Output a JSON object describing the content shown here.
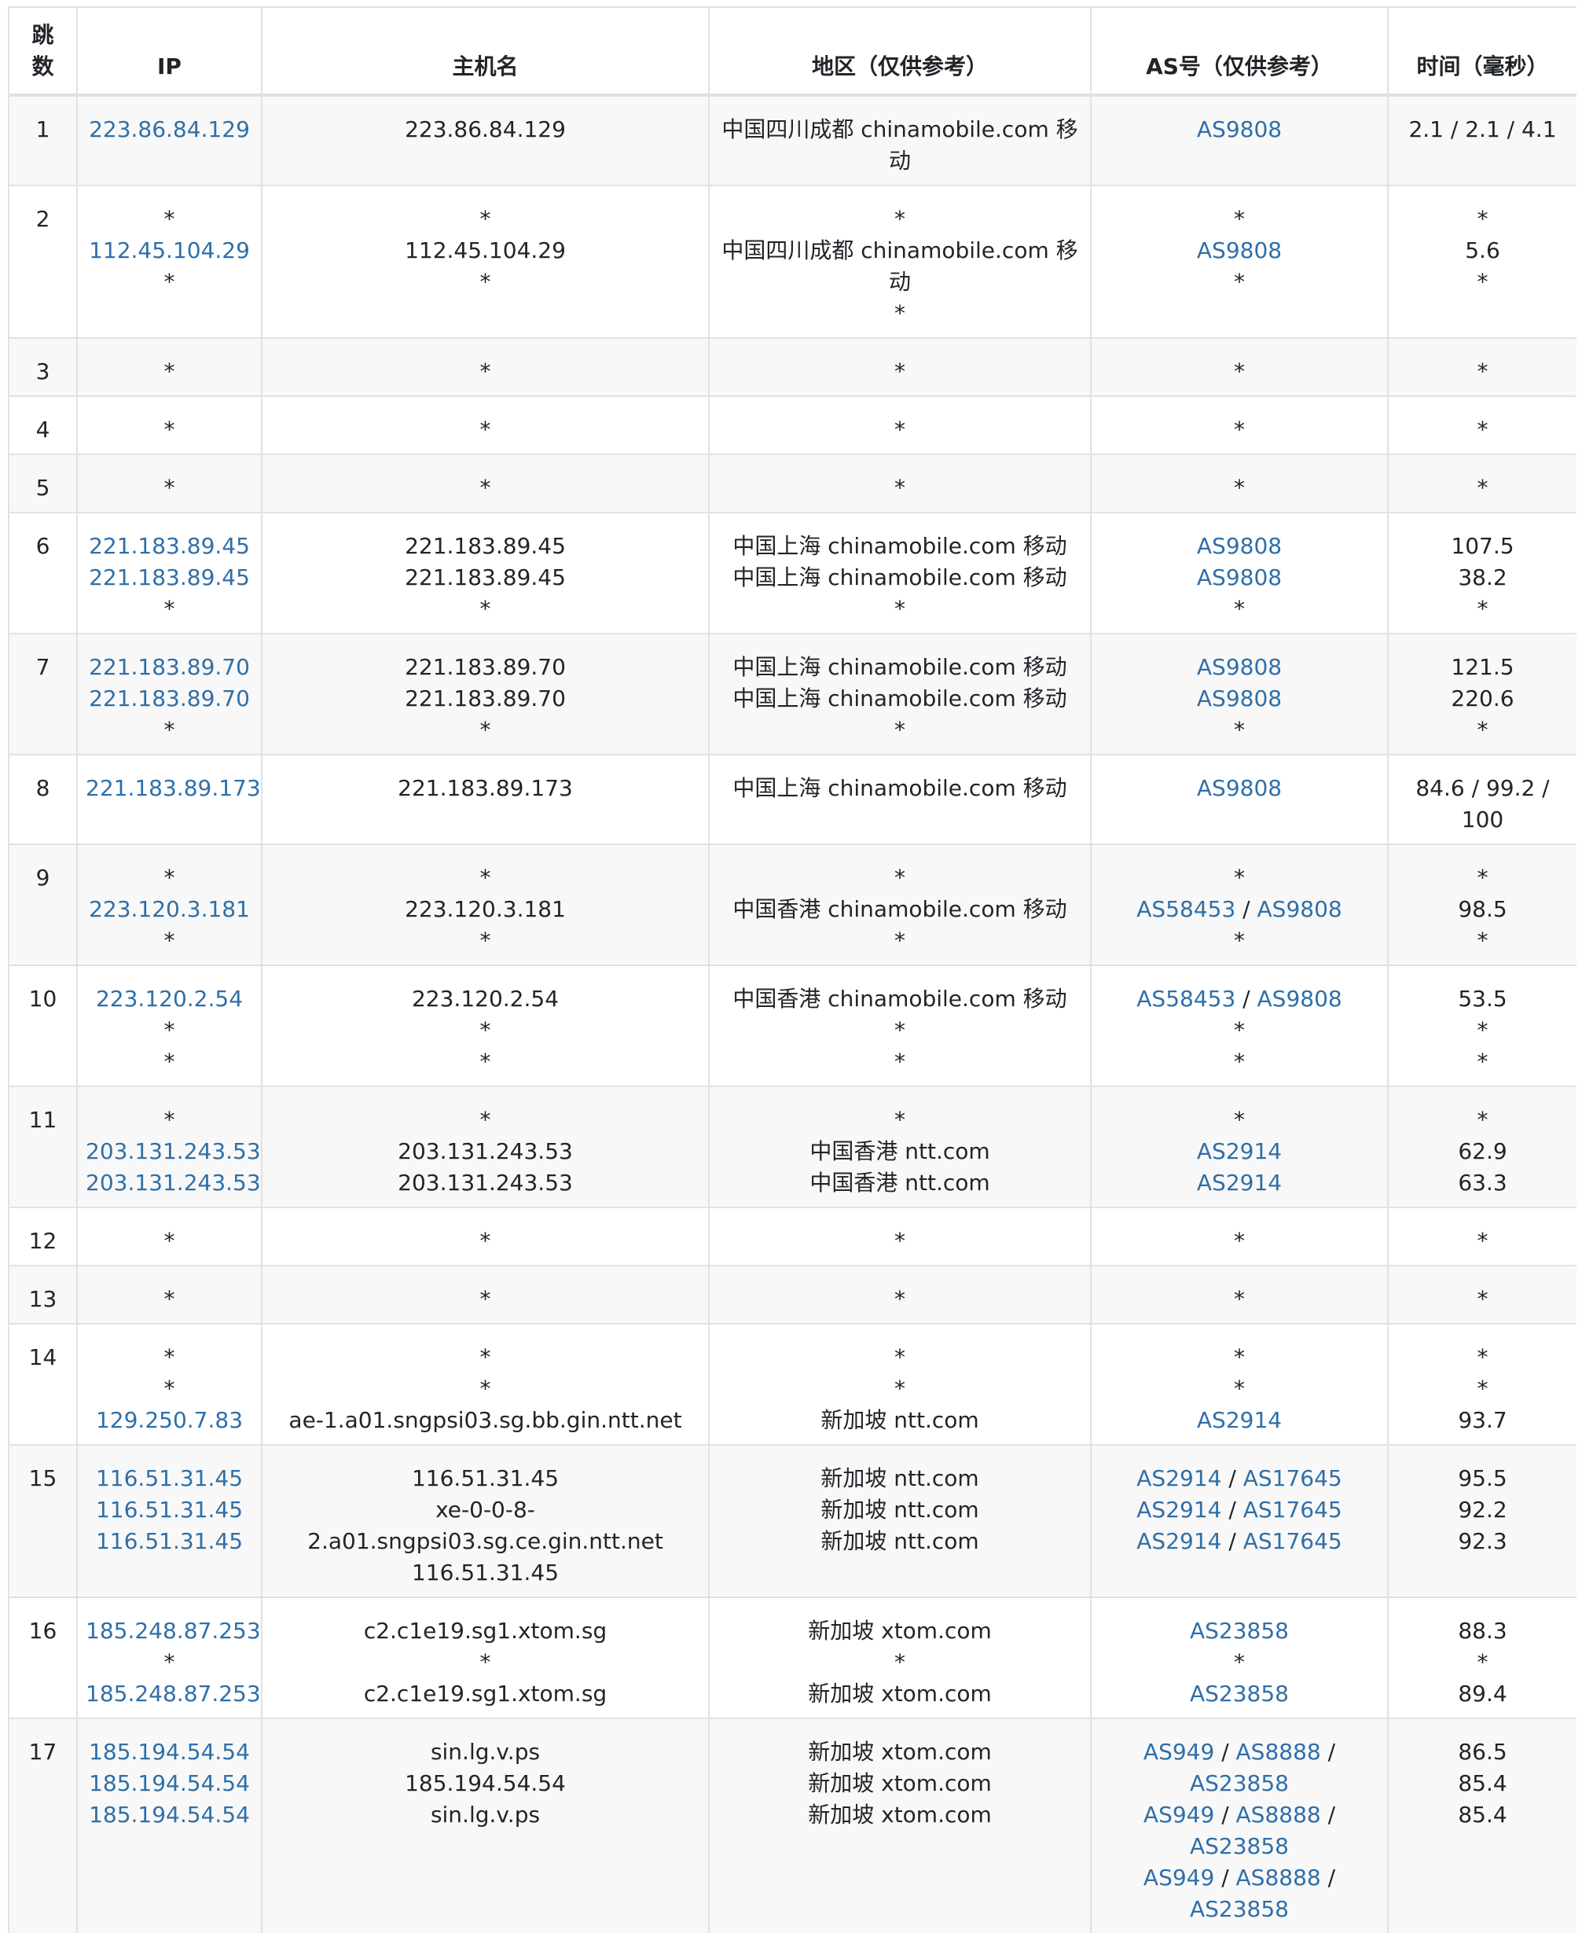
{
  "columns": [
    "跳数",
    "IP",
    "主机名",
    "地区（仅供参考）",
    "AS号（仅供参考）",
    "时间（毫秒）"
  ],
  "hop_header_lines": [
    "跳",
    "数"
  ],
  "rows": [
    {
      "hop": "1",
      "ip": [
        "223.86.84.129"
      ],
      "host": [
        "223.86.84.129"
      ],
      "region": [
        "中国四川成都 chinamobile.com 移动"
      ],
      "as": [
        [
          "AS9808"
        ]
      ],
      "time": [
        "2.1 / 2.1 / 4.1"
      ]
    },
    {
      "hop": "2",
      "ip": [
        "*",
        "112.45.104.29",
        "*"
      ],
      "host": [
        "*",
        "112.45.104.29",
        "*"
      ],
      "region": [
        "*",
        "中国四川成都 chinamobile.com 移动",
        "*"
      ],
      "as": [
        [
          "*"
        ],
        [
          "AS9808"
        ],
        [
          "*"
        ]
      ],
      "time": [
        "*",
        "5.6",
        "*"
      ]
    },
    {
      "hop": "3",
      "ip": [
        "*"
      ],
      "host": [
        "*"
      ],
      "region": [
        "*"
      ],
      "as": [
        [
          "*"
        ]
      ],
      "time": [
        "*"
      ]
    },
    {
      "hop": "4",
      "ip": [
        "*"
      ],
      "host": [
        "*"
      ],
      "region": [
        "*"
      ],
      "as": [
        [
          "*"
        ]
      ],
      "time": [
        "*"
      ]
    },
    {
      "hop": "5",
      "ip": [
        "*"
      ],
      "host": [
        "*"
      ],
      "region": [
        "*"
      ],
      "as": [
        [
          "*"
        ]
      ],
      "time": [
        "*"
      ]
    },
    {
      "hop": "6",
      "ip": [
        "221.183.89.45",
        "221.183.89.45",
        "*"
      ],
      "host": [
        "221.183.89.45",
        "221.183.89.45",
        "*"
      ],
      "region": [
        "中国上海 chinamobile.com 移动",
        "中国上海 chinamobile.com 移动",
        "*"
      ],
      "as": [
        [
          "AS9808"
        ],
        [
          "AS9808"
        ],
        [
          "*"
        ]
      ],
      "time": [
        "107.5",
        "38.2",
        "*"
      ]
    },
    {
      "hop": "7",
      "ip": [
        "221.183.89.70",
        "221.183.89.70",
        "*"
      ],
      "host": [
        "221.183.89.70",
        "221.183.89.70",
        "*"
      ],
      "region": [
        "中国上海 chinamobile.com 移动",
        "中国上海 chinamobile.com 移动",
        "*"
      ],
      "as": [
        [
          "AS9808"
        ],
        [
          "AS9808"
        ],
        [
          "*"
        ]
      ],
      "time": [
        "121.5",
        "220.6",
        "*"
      ]
    },
    {
      "hop": "8",
      "ip": [
        "221.183.89.173"
      ],
      "host": [
        "221.183.89.173"
      ],
      "region": [
        "中国上海 chinamobile.com 移动"
      ],
      "as": [
        [
          "AS9808"
        ]
      ],
      "time": [
        "84.6 / 99.2 / 100"
      ]
    },
    {
      "hop": "9",
      "ip": [
        "*",
        "223.120.3.181",
        "*"
      ],
      "host": [
        "*",
        "223.120.3.181",
        "*"
      ],
      "region": [
        "*",
        "中国香港 chinamobile.com 移动",
        "*"
      ],
      "as": [
        [
          "*"
        ],
        [
          "AS58453",
          "AS9808"
        ],
        [
          "*"
        ]
      ],
      "time": [
        "*",
        "98.5",
        "*"
      ]
    },
    {
      "hop": "10",
      "ip": [
        "223.120.2.54",
        "*",
        "*"
      ],
      "host": [
        "223.120.2.54",
        "*",
        "*"
      ],
      "region": [
        "中国香港 chinamobile.com 移动",
        "*",
        "*"
      ],
      "as": [
        [
          "AS58453",
          "AS9808"
        ],
        [
          "*"
        ],
        [
          "*"
        ]
      ],
      "time": [
        "53.5",
        "*",
        "*"
      ]
    },
    {
      "hop": "11",
      "ip": [
        "*",
        "203.131.243.53",
        "203.131.243.53"
      ],
      "host": [
        "*",
        "203.131.243.53",
        "203.131.243.53"
      ],
      "region": [
        "*",
        "中国香港 ntt.com",
        "中国香港 ntt.com"
      ],
      "as": [
        [
          "*"
        ],
        [
          "AS2914"
        ],
        [
          "AS2914"
        ]
      ],
      "time": [
        "*",
        "62.9",
        "63.3"
      ]
    },
    {
      "hop": "12",
      "ip": [
        "*"
      ],
      "host": [
        "*"
      ],
      "region": [
        "*"
      ],
      "as": [
        [
          "*"
        ]
      ],
      "time": [
        "*"
      ]
    },
    {
      "hop": "13",
      "ip": [
        "*"
      ],
      "host": [
        "*"
      ],
      "region": [
        "*"
      ],
      "as": [
        [
          "*"
        ]
      ],
      "time": [
        "*"
      ]
    },
    {
      "hop": "14",
      "ip": [
        "*",
        "*",
        "129.250.7.83"
      ],
      "host": [
        "*",
        "*",
        "ae-1.a01.sngpsi03.sg.bb.gin.ntt.net"
      ],
      "region": [
        "*",
        "*",
        "新加坡 ntt.com"
      ],
      "as": [
        [
          "*"
        ],
        [
          "*"
        ],
        [
          "AS2914"
        ]
      ],
      "time": [
        "*",
        "*",
        "93.7"
      ]
    },
    {
      "hop": "15",
      "ip": [
        "116.51.31.45",
        "116.51.31.45",
        "116.51.31.45"
      ],
      "host": [
        "116.51.31.45",
        "xe-0-0-8-2.a01.sngpsi03.sg.ce.gin.ntt.net",
        "116.51.31.45"
      ],
      "region": [
        "新加坡 ntt.com",
        "新加坡 ntt.com",
        "新加坡 ntt.com"
      ],
      "as": [
        [
          "AS2914",
          "AS17645"
        ],
        [
          "AS2914",
          "AS17645"
        ],
        [
          "AS2914",
          "AS17645"
        ]
      ],
      "time": [
        "95.5",
        "92.2",
        "92.3"
      ]
    },
    {
      "hop": "16",
      "ip": [
        "185.248.87.253",
        "*",
        "185.248.87.253"
      ],
      "host": [
        "c2.c1e19.sg1.xtom.sg",
        "*",
        "c2.c1e19.sg1.xtom.sg"
      ],
      "region": [
        "新加坡 xtom.com",
        "*",
        "新加坡 xtom.com"
      ],
      "as": [
        [
          "AS23858"
        ],
        [
          "*"
        ],
        [
          "AS23858"
        ]
      ],
      "time": [
        "88.3",
        "*",
        "89.4"
      ]
    },
    {
      "hop": "17",
      "ip": [
        "185.194.54.54",
        "185.194.54.54",
        "185.194.54.54"
      ],
      "host": [
        "sin.lg.v.ps",
        "185.194.54.54",
        "sin.lg.v.ps"
      ],
      "region": [
        "新加坡 xtom.com",
        "新加坡 xtom.com",
        "新加坡 xtom.com"
      ],
      "as": [
        [
          "AS949",
          "AS8888",
          "AS23858"
        ],
        [
          "AS949",
          "AS8888",
          "AS23858"
        ],
        [
          "AS949",
          "AS8888",
          "AS23858"
        ]
      ],
      "time": [
        "86.5",
        "85.4",
        "85.4"
      ]
    }
  ]
}
